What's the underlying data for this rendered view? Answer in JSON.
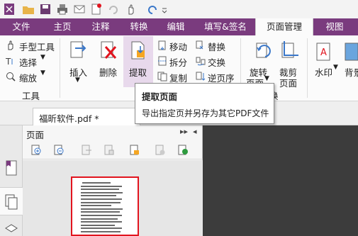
{
  "ribbon_tabs": {
    "file": "文件",
    "home": "主页",
    "annotate": "注释",
    "convert": "转换",
    "edit": "编辑",
    "fill_sign": "填写&签名",
    "page_manage": "页面管理",
    "view": "视图"
  },
  "tools_group": {
    "hand_tool": "手型工具",
    "select": "选择",
    "zoom": "缩放",
    "group_label": "工具"
  },
  "pages_group": {
    "insert": "插入",
    "delete": "删除",
    "extract": "提取",
    "move": "移动",
    "split": "拆分",
    "copy": "复制",
    "replace": "替换",
    "swap": "交换",
    "reverse": "逆页序",
    "group_label_fragment": "换"
  },
  "rotate_group": {
    "rotate_line1": "旋转",
    "rotate_line2": "页面",
    "crop_line1": "裁剪",
    "crop_line2": "页面",
    "watermark": "水印",
    "background": "背景"
  },
  "tooltip": {
    "title": "提取页面",
    "description": "导出指定页并另存为其它PDF文件"
  },
  "document": {
    "tab_title": "福昕软件.pdf *"
  },
  "page_panel": {
    "title": "页面"
  },
  "colors": {
    "accent": "#7a3b7e",
    "selection_red": "#e2141e",
    "extract_highlight": "#e8d9ec"
  }
}
